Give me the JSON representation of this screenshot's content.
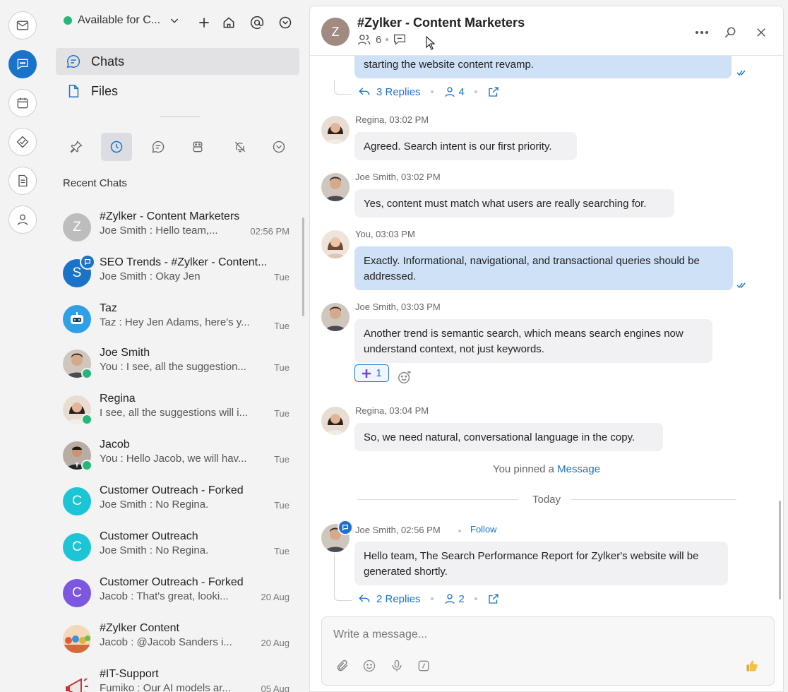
{
  "sidebar": {
    "status": "Available for C...",
    "nav": [
      {
        "label": "Chats",
        "icon": "chat-bubble-icon"
      },
      {
        "label": "Files",
        "icon": "file-icon"
      }
    ],
    "recent_label": "Recent Chats",
    "chats": [
      {
        "name": "#Zylker - Content Marketers",
        "preview": "Joe Smith : Hello team,...",
        "time": "02:56 PM",
        "initial": "Z",
        "color": "#bdbdbd"
      },
      {
        "name": "SEO Trends - #Zylker - Content...",
        "preview": "Joe Smith : Okay Jen",
        "time": "Tue",
        "initial": "S",
        "color": "#1a73c9"
      },
      {
        "name": "Taz",
        "preview": "Taz : Hey Jen Adams, here's y...",
        "time": "Tue",
        "initial": "",
        "color": "#2ea0e8"
      },
      {
        "name": "Joe Smith",
        "preview": "You : I see, all the suggestion...",
        "time": "Tue",
        "initial": "",
        "color": "#8a7a6e"
      },
      {
        "name": "Regina",
        "preview": "I see, all the suggestions will i...",
        "time": "Tue",
        "initial": "",
        "color": "#c9a08b"
      },
      {
        "name": "Jacob",
        "preview": "You : Hello Jacob, we will hav...",
        "time": "Tue",
        "initial": "",
        "color": "#5a4a40"
      },
      {
        "name": "Customer Outreach - Forked",
        "preview": "Joe Smith : No Regina.",
        "time": "Tue",
        "initial": "C",
        "color": "#1cc5d6"
      },
      {
        "name": "Customer Outreach",
        "preview": "Joe Smith : No Regina.",
        "time": "Tue",
        "initial": "C",
        "color": "#1cc5d6"
      },
      {
        "name": "Customer Outreach - Forked",
        "preview": "Jacob : That's great, looki...",
        "time": "20 Aug",
        "initial": "C",
        "color": "#7e57e0"
      },
      {
        "name": "#Zylker Content",
        "preview": "Jacob : @Jacob Sanders  i...",
        "time": "20 Aug",
        "initial": "",
        "color": "#e06b3f"
      },
      {
        "name": "#IT-Support",
        "preview": "Fumiko : Our AI models ar...",
        "time": "05 Aug",
        "initial": "",
        "color": "#e0e0e0"
      }
    ]
  },
  "header": {
    "title": "#Zylker - Content Marketers",
    "initial": "Z",
    "members": "6"
  },
  "messages": {
    "top_partial": "starting the website content revamp.",
    "top_replies": "3 Replies",
    "top_participants": "4",
    "m1_sender": "Regina, 03:02 PM",
    "m1_text": "Agreed. Search intent is our first priority.",
    "m2_sender": "Joe Smith, 03:02 PM",
    "m2_text": "Yes, content must match what users are really searching for.",
    "m3_sender": "You, 03:03 PM",
    "m3_text": "Exactly. Informational, navigational, and transactional queries should be addressed.",
    "m4_sender": "Joe Smith, 03:03 PM",
    "m4_text": "Another trend is semantic search, which means search engines now understand context, not just keywords.",
    "m4_reaction_count": "1",
    "m5_sender": "Regina, 03:04 PM",
    "m5_text": "So, we need natural, conversational language in the copy.",
    "pinned_prefix": "You pinned a",
    "pinned_link": "Message",
    "day_separator": "Today",
    "m6_sender": "Joe Smith, 02:56 PM",
    "m6_follow": "Follow",
    "m6_text": "Hello team, The Search Performance Report for Zylker's website will be generated shortly.",
    "m6_replies": "2 Replies",
    "m6_participants": "2"
  },
  "composer": {
    "placeholder": "Write a message..."
  }
}
